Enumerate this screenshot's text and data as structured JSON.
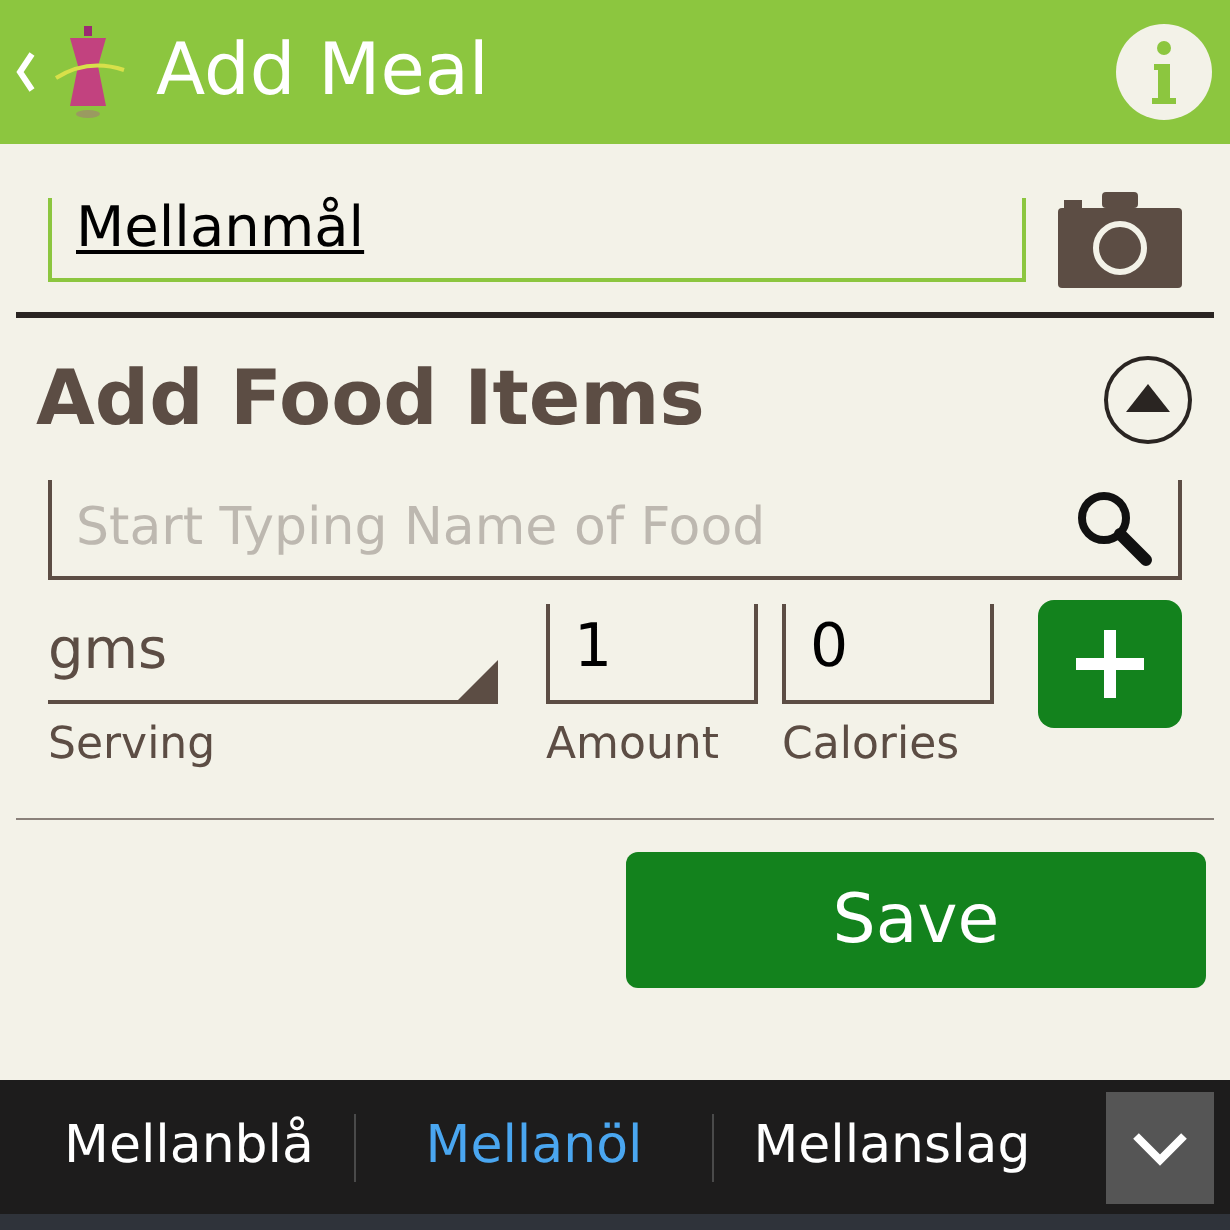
{
  "header": {
    "title": "Add Meal"
  },
  "meal_name": {
    "value": "Mellanmål"
  },
  "section": {
    "title": "Add Food Items",
    "expanded": true
  },
  "search": {
    "placeholder": "Start Typing Name of Food"
  },
  "serving": {
    "value": "gms",
    "label": "Serving"
  },
  "amount": {
    "value": "1",
    "label": "Amount"
  },
  "calories": {
    "value": "0",
    "label": "Calories"
  },
  "save_button": "Save",
  "suggestions": [
    {
      "text": "Mellanblå",
      "selected": false
    },
    {
      "text": "Mellanöl",
      "selected": true
    },
    {
      "text": "Mellanslag",
      "selected": false
    }
  ]
}
